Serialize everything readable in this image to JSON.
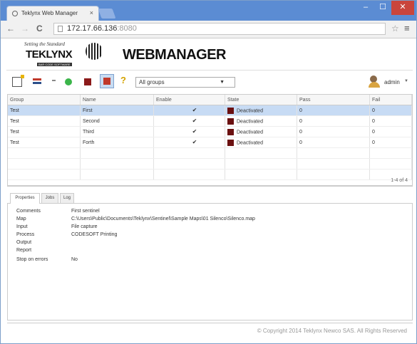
{
  "browser": {
    "tab_title": "Teklynx Web Manager",
    "tab_close": "×",
    "url_host": "172.17.66.136",
    "url_port": ":8080",
    "window_controls": {
      "minimize": "–",
      "maximize": "☐",
      "close": "✕"
    }
  },
  "header": {
    "logo_tagline": "Setting the Standard",
    "logo_brand": "TEKLYNX",
    "logo_sub": "BAR CODE SOFTWARE",
    "product_name": "WEBMANAGER"
  },
  "toolbar": {
    "group_filter": "All groups",
    "user_name": "admin",
    "help_glyph": "?"
  },
  "grid": {
    "columns": [
      "Group",
      "Name",
      "Enable",
      "State",
      "Pass",
      "Fail"
    ],
    "rows": [
      {
        "group": "Test",
        "name": "First",
        "enabled": true,
        "state": "Deactivated",
        "pass": "0",
        "fail": "0",
        "selected": true
      },
      {
        "group": "Test",
        "name": "Second",
        "enabled": true,
        "state": "Deactivated",
        "pass": "0",
        "fail": "0",
        "selected": false
      },
      {
        "group": "Test",
        "name": "Third",
        "enabled": true,
        "state": "Deactivated",
        "pass": "0",
        "fail": "0",
        "selected": false
      },
      {
        "group": "Test",
        "name": "Forth",
        "enabled": true,
        "state": "Deactivated",
        "pass": "0",
        "fail": "0",
        "selected": false
      }
    ],
    "pager": "1-4 of 4",
    "state_color": "#6b1010"
  },
  "panel": {
    "tabs": [
      "Properties",
      "Jobs",
      "Log"
    ],
    "active_tab": "Properties",
    "properties": [
      {
        "label": "Comments",
        "value": "First sentinel"
      },
      {
        "label": "Map",
        "value": "C:\\Users\\Public\\Documents\\Teklynx\\Sentinel\\Sample Maps\\01 Silenco\\Silenco.map"
      },
      {
        "label": "Input",
        "value": "File capture"
      },
      {
        "label": "Process",
        "value": "CODESOFT Printing"
      },
      {
        "label": "Output",
        "value": ""
      },
      {
        "label": "Report",
        "value": ""
      },
      {
        "label": "Stop on errors",
        "value": "No"
      }
    ]
  },
  "footer": {
    "copyright": "© Copyright 2014 Teklynx Newco SAS. All Rights Reserved"
  },
  "colors": {
    "titlebar": "#5b8cd3",
    "selected_row": "#c7dbf4",
    "close_button": "#c9453c"
  }
}
